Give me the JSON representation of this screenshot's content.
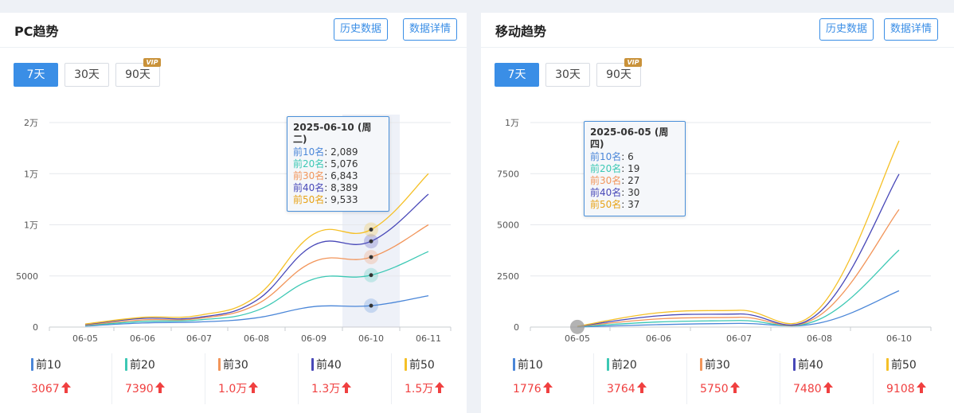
{
  "colors": {
    "s10": "#4a86d8",
    "s20": "#3cc8b4",
    "s30": "#f2955a",
    "s40": "#4848b8",
    "s50": "#f5c027",
    "accent": "#3a8ee6",
    "up": "#f04040"
  },
  "buttons": {
    "history": "历史数据",
    "detail": "数据详情"
  },
  "ranges": [
    "7天",
    "30天",
    "90天"
  ],
  "vip_badge": "VIP",
  "pc": {
    "title": "PC趋势",
    "tooltip": {
      "date": "2025-06-10 (周二)",
      "rows": [
        {
          "label": "前10名",
          "value": "2,089"
        },
        {
          "label": "前20名",
          "value": "5,076"
        },
        {
          "label": "前30名",
          "value": "6,843"
        },
        {
          "label": "前40名",
          "value": "8,389"
        },
        {
          "label": "前50名",
          "value": "9,533"
        }
      ]
    },
    "legend": [
      {
        "name": "前10",
        "value": "3067"
      },
      {
        "name": "前20",
        "value": "7390"
      },
      {
        "name": "前30",
        "value": "1.0万"
      },
      {
        "name": "前40",
        "value": "1.3万"
      },
      {
        "name": "前50",
        "value": "1.5万"
      }
    ]
  },
  "mobile": {
    "title": "移动趋势",
    "tooltip": {
      "date": "2025-06-05 (周四)",
      "rows": [
        {
          "label": "前10名",
          "value": "6"
        },
        {
          "label": "前20名",
          "value": "19"
        },
        {
          "label": "前30名",
          "value": "27"
        },
        {
          "label": "前40名",
          "value": "30"
        },
        {
          "label": "前50名",
          "value": "37"
        }
      ]
    },
    "legend": [
      {
        "name": "前10",
        "value": "1776"
      },
      {
        "name": "前20",
        "value": "3764"
      },
      {
        "name": "前30",
        "value": "5750"
      },
      {
        "name": "前40",
        "value": "7480"
      },
      {
        "name": "前50",
        "value": "9108"
      }
    ]
  },
  "chart_data": [
    {
      "type": "line",
      "x": [
        "06-05",
        "06-06",
        "06-07",
        "06-08",
        "06-09",
        "06-10",
        "06-11"
      ],
      "y_ticks": [
        0,
        5000,
        10000,
        15000,
        20000
      ],
      "y_tick_labels": [
        "0",
        "5000",
        "1万",
        "1万",
        "2万"
      ],
      "ylim": [
        0,
        20000
      ],
      "highlight_x": "06-10",
      "series": [
        {
          "name": "前10",
          "color": "#4a86d8",
          "values": [
            100,
            400,
            500,
            900,
            2000,
            2089,
            3067
          ]
        },
        {
          "name": "前20",
          "color": "#3cc8b4",
          "values": [
            150,
            550,
            700,
            1600,
            4700,
            5076,
            7390
          ]
        },
        {
          "name": "前30",
          "color": "#f2955a",
          "values": [
            200,
            700,
            850,
            2200,
            6400,
            6843,
            10000
          ]
        },
        {
          "name": "前40",
          "color": "#4848b8",
          "values": [
            250,
            850,
            950,
            2600,
            8000,
            8389,
            13000
          ]
        },
        {
          "name": "前50",
          "color": "#f5c027",
          "values": [
            300,
            950,
            1150,
            3000,
            9100,
            9533,
            15000
          ]
        }
      ]
    },
    {
      "type": "line",
      "x": [
        "06-05",
        "06-06",
        "06-07",
        "06-08",
        "06-10"
      ],
      "y_ticks": [
        0,
        2500,
        5000,
        7500,
        10000
      ],
      "y_tick_labels": [
        "0",
        "2500",
        "5000",
        "7500",
        "1万"
      ],
      "ylim": [
        0,
        10000
      ],
      "highlight_x": "06-05",
      "series": [
        {
          "name": "前10",
          "color": "#4a86d8",
          "values": [
            6,
            120,
            180,
            200,
            1776
          ]
        },
        {
          "name": "前20",
          "color": "#3cc8b4",
          "values": [
            19,
            250,
            320,
            380,
            3764
          ]
        },
        {
          "name": "前30",
          "color": "#f2955a",
          "values": [
            27,
            400,
            480,
            560,
            5750
          ]
        },
        {
          "name": "前40",
          "color": "#4848b8",
          "values": [
            30,
            550,
            640,
            720,
            7480
          ]
        },
        {
          "name": "前50",
          "color": "#f5c027",
          "values": [
            37,
            700,
            820,
            920,
            9108
          ]
        }
      ]
    }
  ]
}
